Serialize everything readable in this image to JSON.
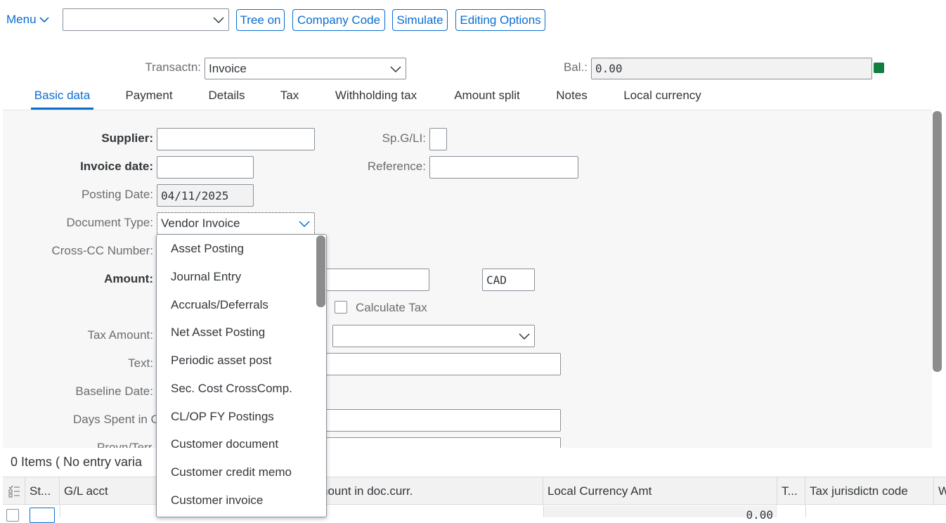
{
  "toolbar": {
    "menu_label": "Menu",
    "combo_value": "",
    "buttons": [
      "Tree on",
      "Company Code",
      "Simulate",
      "Editing Options"
    ]
  },
  "header": {
    "transaction_label": "Transactn:",
    "transaction_value": "Invoice",
    "balance_label": "Bal.:",
    "balance_value": "0.00",
    "balance_status_color": "#107e3e"
  },
  "tabs": [
    "Basic data",
    "Payment",
    "Details",
    "Tax",
    "Withholding tax",
    "Amount split",
    "Notes",
    "Local currency"
  ],
  "active_tab": "Basic data",
  "form": {
    "supplier_label": "Supplier:",
    "supplier_value": "",
    "spgl_label": "Sp.G/LI:",
    "spgl_value": "",
    "invoice_date_label": "Invoice date:",
    "invoice_date_value": "",
    "reference_label": "Reference:",
    "reference_value": "",
    "posting_date_label": "Posting Date:",
    "posting_date_value": "04/11/2025",
    "doc_type_label": "Document Type:",
    "doc_type_value": "Vendor Invoice",
    "cross_cc_label": "Cross-CC Number:",
    "amount_label": "Amount:",
    "amount_value": "",
    "currency_value": "CAD",
    "calc_tax_label": "Calculate Tax",
    "tax_amount_label": "Tax Amount:",
    "tax_code_value": "",
    "text_label": "Text:",
    "text_value": "",
    "baseline_date_label": "Baseline Date:",
    "days_spent_label": "Days Spent in C",
    "provn_label": "Provn/Terr"
  },
  "dropdown": {
    "items": [
      "Asset Posting",
      "Journal Entry",
      "Accruals/Deferrals",
      "Net Asset Posting",
      "Periodic asset post",
      "Sec. Cost CrossComp.",
      "CL/OP FY Postings",
      "Customer document",
      "Customer credit memo",
      "Customer invoice"
    ]
  },
  "items_section": {
    "title": "0 Items ( No entry varia",
    "columns": [
      "St...",
      "G/L acct",
      "nount in doc.curr.",
      "Local Currency Amt",
      "T...",
      "Tax jurisdictn code",
      "W"
    ],
    "row_local_amount": "0.00"
  }
}
